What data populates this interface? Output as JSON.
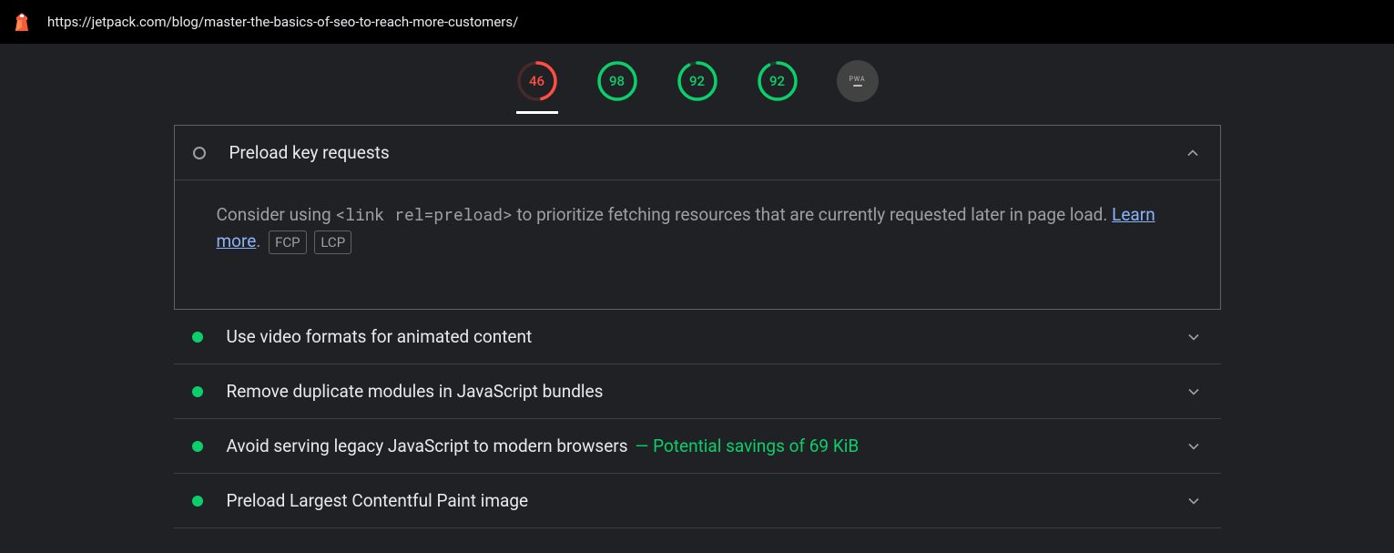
{
  "topbar": {
    "url": "https://jetpack.com/blog/master-the-basics-of-seo-to-reach-more-customers/"
  },
  "gauges": [
    {
      "score": "46",
      "value": 46,
      "color": "#ff4e42",
      "cls": "red",
      "active": true
    },
    {
      "score": "98",
      "value": 98,
      "color": "#0cce6b",
      "cls": "green",
      "active": false
    },
    {
      "score": "92",
      "value": 92,
      "color": "#0cce6b",
      "cls": "green",
      "active": false
    },
    {
      "score": "92",
      "value": 92,
      "color": "#0cce6b",
      "cls": "green",
      "active": false
    }
  ],
  "pwa_label": "PWA",
  "audits": {
    "expanded": {
      "title": "Preload key requests",
      "desc_prefix": "Consider using ",
      "desc_code": "<link rel=preload>",
      "desc_suffix": " to prioritize fetching resources that are currently requested later in page load. ",
      "learn_more": "Learn more",
      "period": ".",
      "tags": [
        "FCP",
        "LCP"
      ]
    },
    "list": [
      {
        "title": "Use video formats for animated content",
        "savings": ""
      },
      {
        "title": "Remove duplicate modules in JavaScript bundles",
        "savings": ""
      },
      {
        "title": "Avoid serving legacy JavaScript to modern browsers",
        "savings": " — Potential savings of 69 KiB"
      },
      {
        "title": "Preload Largest Contentful Paint image",
        "savings": ""
      }
    ]
  }
}
